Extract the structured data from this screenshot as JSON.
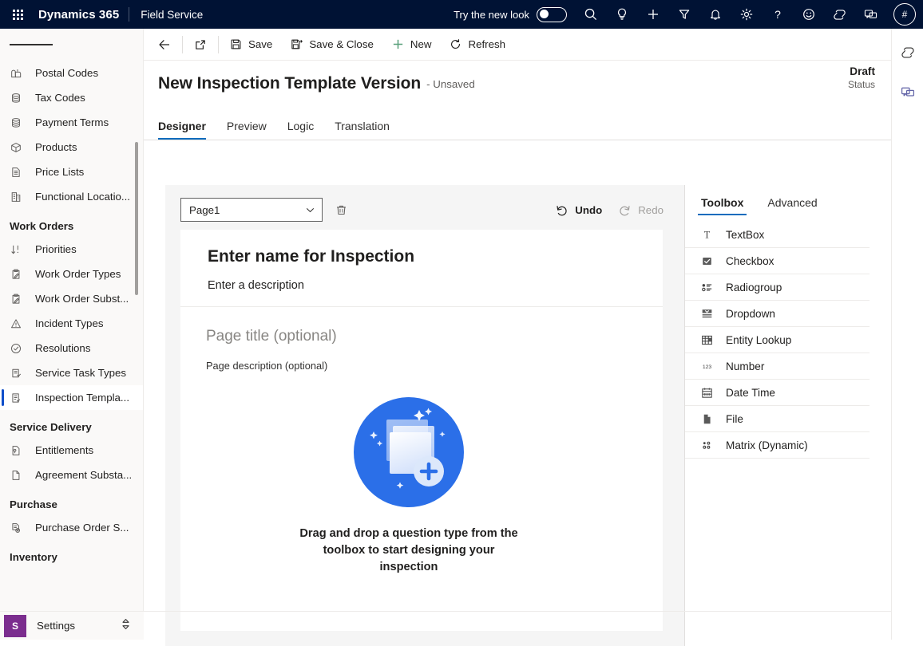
{
  "appbar": {
    "waffle_label": "app-launcher",
    "brand": "Dynamics 365",
    "app_name": "Field Service",
    "new_look_label": "Try the new look",
    "new_look_enabled": false,
    "icons": [
      {
        "name": "search-icon",
        "title": "Search"
      },
      {
        "name": "lightbulb-icon",
        "title": "Insights"
      },
      {
        "name": "plus-icon",
        "title": "Quick create"
      },
      {
        "name": "filter-icon",
        "title": "Filter"
      },
      {
        "name": "bell-icon",
        "title": "Notifications"
      },
      {
        "name": "gear-icon",
        "title": "Settings"
      },
      {
        "name": "help-icon",
        "title": "Help"
      },
      {
        "name": "smiley-icon",
        "title": "Feedback"
      },
      {
        "name": "copilot-icon",
        "title": "Copilot"
      },
      {
        "name": "chat-icon",
        "title": "Teams chat"
      }
    ],
    "avatar_initials": "#"
  },
  "sidebar": {
    "hamburger_label": "Show menu",
    "items": [
      {
        "label": "Postal Codes",
        "icon": "mailbox-icon",
        "type": "item",
        "selected": false
      },
      {
        "label": "Tax Codes",
        "icon": "stack-icon",
        "type": "item",
        "selected": false
      },
      {
        "label": "Payment Terms",
        "icon": "stack-icon",
        "type": "item",
        "selected": false
      },
      {
        "label": "Products",
        "icon": "box-icon",
        "type": "item",
        "selected": false
      },
      {
        "label": "Price Lists",
        "icon": "document-list-icon",
        "type": "item",
        "selected": false
      },
      {
        "label": "Functional Locatio...",
        "icon": "building-icon",
        "type": "item",
        "selected": false
      },
      {
        "label": "Work Orders",
        "type": "group"
      },
      {
        "label": "Priorities",
        "icon": "sort-icon",
        "type": "item",
        "selected": false
      },
      {
        "label": "Work Order Types",
        "icon": "clipboard-icon",
        "type": "item",
        "selected": false
      },
      {
        "label": "Work Order Subst...",
        "icon": "clipboard-icon",
        "type": "item",
        "selected": false
      },
      {
        "label": "Incident Types",
        "icon": "warning-icon",
        "type": "item",
        "selected": false
      },
      {
        "label": "Resolutions",
        "icon": "check-circle-icon",
        "type": "item",
        "selected": false
      },
      {
        "label": "Service Task Types",
        "icon": "task-icon",
        "type": "item",
        "selected": false
      },
      {
        "label": "Inspection Templa...",
        "icon": "inspection-icon",
        "type": "item",
        "selected": true
      },
      {
        "label": "Service Delivery",
        "type": "group"
      },
      {
        "label": "Entitlements",
        "icon": "entitlement-icon",
        "type": "item",
        "selected": false
      },
      {
        "label": "Agreement Substa...",
        "icon": "document-icon",
        "type": "item",
        "selected": false
      },
      {
        "label": "Purchase",
        "type": "group"
      },
      {
        "label": "Purchase Order S...",
        "icon": "purchase-icon",
        "type": "item",
        "selected": false
      },
      {
        "label": "Inventory",
        "type": "group"
      }
    ],
    "settings": {
      "badge": "S",
      "label": "Settings"
    }
  },
  "commandbar": {
    "back_label": "Back",
    "popout_label": "Open in new window",
    "buttons": [
      {
        "label": "Save",
        "icon": "save-icon"
      },
      {
        "label": "Save & Close",
        "icon": "save-close-icon"
      },
      {
        "label": "New",
        "icon": "plus-icon"
      },
      {
        "label": "Refresh",
        "icon": "refresh-icon"
      }
    ]
  },
  "record": {
    "title": "New Inspection Template Version",
    "unsaved": "- Unsaved",
    "status_value": "Draft",
    "status_label": "Status"
  },
  "tabs": [
    {
      "label": "Designer",
      "active": true
    },
    {
      "label": "Preview",
      "active": false
    },
    {
      "label": "Logic",
      "active": false
    },
    {
      "label": "Translation",
      "active": false
    }
  ],
  "designer": {
    "page_select_value": "Page1",
    "delete_page_label": "Delete page",
    "undo_label": "Undo",
    "redo_label": "Redo",
    "undo_enabled": true,
    "redo_enabled": false,
    "inspection_name_placeholder": "Enter name for Inspection",
    "inspection_description_placeholder": "Enter a description",
    "page_title_placeholder": "Page title (optional)",
    "page_description_placeholder": "Page description (optional)",
    "empty_state_text": "Drag and drop a question type from the toolbox to start designing your inspection"
  },
  "toolbox": {
    "tabs": [
      {
        "label": "Toolbox",
        "active": true
      },
      {
        "label": "Advanced",
        "active": false
      }
    ],
    "items": [
      {
        "label": "TextBox",
        "icon": "textbox-icon"
      },
      {
        "label": "Checkbox",
        "icon": "checkbox-icon"
      },
      {
        "label": "Radiogroup",
        "icon": "radiogroup-icon"
      },
      {
        "label": "Dropdown",
        "icon": "dropdown-icon"
      },
      {
        "label": "Entity Lookup",
        "icon": "entity-lookup-icon"
      },
      {
        "label": "Number",
        "icon": "number-icon"
      },
      {
        "label": "Date Time",
        "icon": "calendar-icon"
      },
      {
        "label": "File",
        "icon": "file-icon"
      },
      {
        "label": "Matrix (Dynamic)",
        "icon": "matrix-icon"
      }
    ]
  },
  "rightrail": {
    "items": [
      {
        "name": "copilot-icon",
        "label": "Copilot"
      },
      {
        "name": "chat-icon",
        "label": "Chat"
      }
    ]
  },
  "colors": {
    "appbar_bg": "#001234",
    "accent": "#0f6cbd",
    "selected_indicator": "#0f4ec9",
    "settings_badge": "#7b2d8e",
    "illustration_blue": "#2b6fe8",
    "canvas_bg": "#f5f5f5",
    "new_green": "#59a07a"
  }
}
